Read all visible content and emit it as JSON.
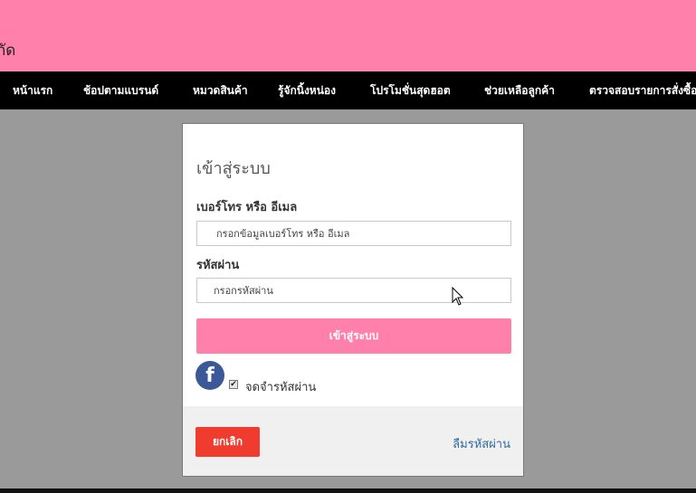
{
  "header": {
    "brand": "กัด"
  },
  "nav": {
    "items": [
      {
        "label": "หน้าแรก"
      },
      {
        "label": "ช้อปตามแบรนด์"
      },
      {
        "label": "หมวดสินค้า"
      },
      {
        "label": "รู้จักนิ้งหน่อง"
      },
      {
        "label": "โปรโมชั่นสุดฮอต"
      },
      {
        "label": "ช่วยเหลือลูกค้า"
      },
      {
        "label": "ตรวจสอบรายการสั่งซื้อ"
      }
    ]
  },
  "login_modal": {
    "title": "เข้าสู่ระบบ",
    "identifier": {
      "label": "เบอร์โทร หรือ อีเมล",
      "placeholder": "กรอกข้อมูลเบอร์โทร หรือ อีเมล"
    },
    "password": {
      "label": "รหัสผ่าน",
      "placeholder": "กรอกรหัสผ่าน"
    },
    "submit_label": "เข้าสู่ระบบ",
    "facebook_icon": "f",
    "remember": {
      "label": "จดจำรหัสผ่าน",
      "checked": true,
      "mark": "✔"
    },
    "cancel_label": "ยกเลิก",
    "forgot_label": "ลืมรหัสผ่าน"
  },
  "colors": {
    "brand_pink": "#ff80ab",
    "nav_background": "#000000",
    "overlay": "#9a9a9a",
    "cancel_red": "#f03b2f",
    "facebook_blue": "#3b5998",
    "link_blue": "#2f6aa6"
  }
}
